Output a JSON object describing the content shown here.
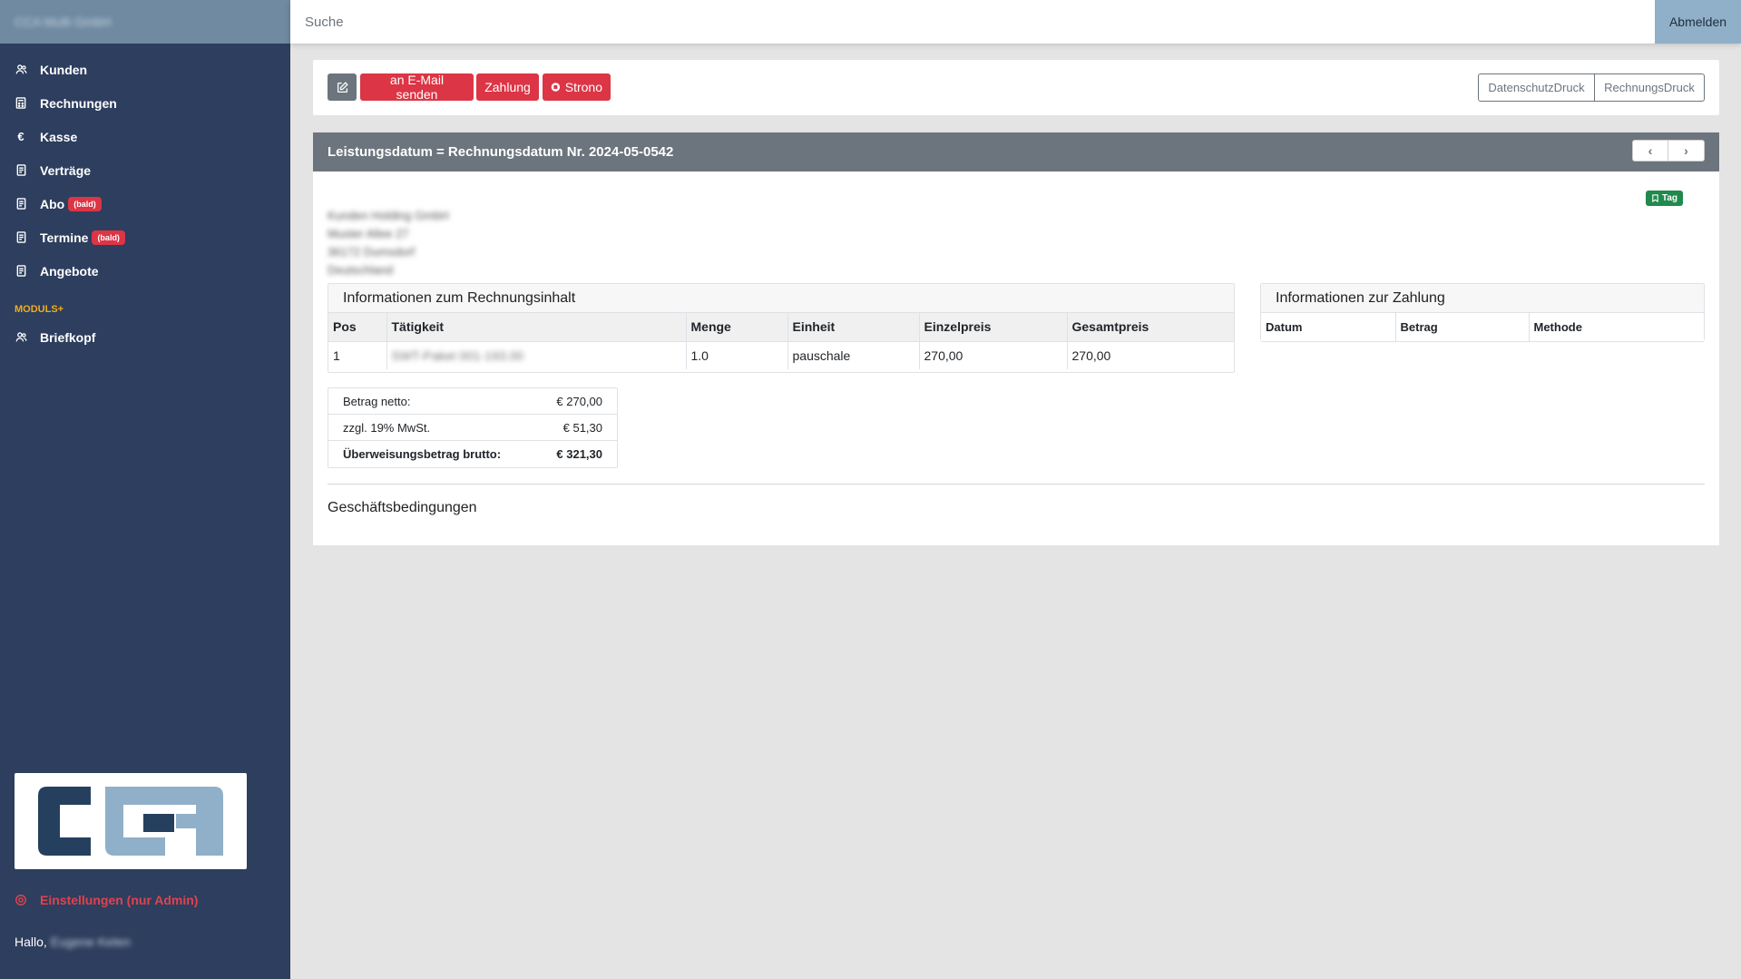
{
  "sidebar": {
    "brand": "CCA Multi GmbH",
    "items": [
      {
        "label": "Kunden",
        "icon": "users-icon"
      },
      {
        "label": "Rechnungen",
        "icon": "calculator-icon"
      },
      {
        "label": "Kasse",
        "icon": "euro-icon"
      },
      {
        "label": "Verträge",
        "icon": "document-icon"
      },
      {
        "label": "Abo",
        "icon": "document-icon",
        "badge": "(bald)"
      },
      {
        "label": "Termine",
        "icon": "document-icon",
        "badge": "(bald)"
      },
      {
        "label": "Angebote",
        "icon": "document-icon"
      }
    ],
    "section_header": "MODULS+",
    "module_items": [
      {
        "label": "Briefkopf",
        "icon": "users-icon"
      }
    ],
    "settings_label": "Einstellungen (nur Admin)",
    "hello_prefix": "Hallo,",
    "hello_name": "Eugene Kelen"
  },
  "topbar": {
    "search_placeholder": "Suche",
    "logout_label": "Abmelden"
  },
  "toolbar": {
    "email_label": "an E-Mail senden",
    "payment_label": "Zahlung",
    "storno_label": "Strono",
    "print_privacy_label": "DatenschutzDruck",
    "print_invoice_label": "RechnungsDruck"
  },
  "invoice": {
    "title": "Leistungsdatum = Rechnungsdatum Nr. 2024-05-0542",
    "tag_label": "Tag",
    "address": [
      "Kunden Holding GmbH",
      "Muster Allee 27",
      "36172 Dumsdorf",
      "Deutschland"
    ],
    "content_panel": {
      "title": "Informationen zum Rechnungsinhalt",
      "headers": [
        "Pos",
        "Tätigkeit",
        "Menge",
        "Einheit",
        "Einzelpreis",
        "Gesamtpreis"
      ],
      "rows": [
        {
          "pos": "1",
          "activity": "SWT-Paket 001-193.00",
          "qty": "1.0",
          "unit": "pauschale",
          "unit_price": "270,00",
          "total": "270,00"
        }
      ]
    },
    "payment_panel": {
      "title": "Informationen zur Zahlung",
      "headers": [
        "Datum",
        "Betrag",
        "Methode"
      ]
    },
    "totals": {
      "net_label": "Betrag netto:",
      "net_value": "€ 270,00",
      "vat_label": "zzgl. 19% MwSt.",
      "vat_value": "€ 51,30",
      "gross_label": "Überweisungsbetrag brutto:",
      "gross_value": "€ 321,30"
    },
    "terms_title": "Geschäftsbedingungen"
  },
  "colors": {
    "sidebar_bg": "#2d3e5e",
    "brand_bg": "#6f8aa1",
    "accent_red": "#dc3545",
    "header_gray": "#6c757d",
    "tag_green": "#1f8a4c",
    "section_orange": "#f0ad1c"
  }
}
